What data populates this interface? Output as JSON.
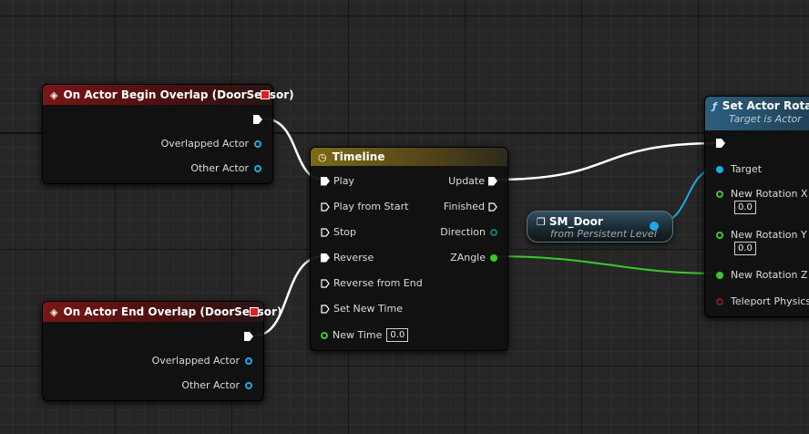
{
  "begin_overlap": {
    "title": "On Actor Begin Overlap (DoorSensor)",
    "pins": [
      "Overlapped Actor",
      "Other Actor"
    ]
  },
  "end_overlap": {
    "title": "On Actor End Overlap (DoorSensor)",
    "pins": [
      "Overlapped Actor",
      "Other Actor"
    ]
  },
  "timeline": {
    "title": "Timeline",
    "inputs": [
      "Play",
      "Play from Start",
      "Stop",
      "Reverse",
      "Reverse from End",
      "Set New Time",
      "New Time"
    ],
    "new_time_value": "0.0",
    "outputs": [
      "Update",
      "Finished",
      "Direction",
      "ZAngle"
    ]
  },
  "sm_door": {
    "title": "SM_Door",
    "subtitle": "from Persistent Level"
  },
  "set_rotation": {
    "title": "Set Actor Rotatio",
    "subtitle": "Target is Actor",
    "pins": {
      "target": "Target",
      "rot_x": "New Rotation X (I",
      "rot_y": "New Rotation Y (I",
      "rot_z": "New Rotation Z (Y",
      "teleport": "Teleport Physics"
    },
    "rot_x_value": "0.0",
    "rot_y_value": "0.0"
  },
  "colors": {
    "exec": "#ffffff",
    "object": "#1fa8e6",
    "float": "#3ac92a",
    "bool": "#8a1a1a"
  }
}
